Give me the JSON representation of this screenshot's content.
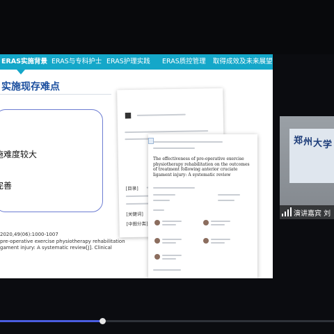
{
  "nav": {
    "items": [
      {
        "label": "ERAS实施背景",
        "active": true
      },
      {
        "label": "ERAS与专科护士",
        "active": false
      },
      {
        "label": "ERAS护理实践",
        "active": false
      },
      {
        "label": "ERAS质控管理",
        "active": false
      },
      {
        "label": "取得成效及未来展望",
        "active": false
      }
    ]
  },
  "slide": {
    "title": "实施现存难点",
    "points": [
      "施难度较大",
      "完善"
    ],
    "reference_lines": [
      "2020,49(06):1000-1007",
      "pre-operative exercise physiotherapy rehabilitation",
      "gament injury: A systematic review[J]. Clinical"
    ]
  },
  "papers": {
    "front_title": "The effectiveness of pre-operative exercise physiotherapy rehabilitation on the outcomes of treatment following anterior cruciate ligament injury: A systematic review",
    "back_chars": [
      "■",
      "[目录]",
      "[关键词]",
      "[中图分类]"
    ]
  },
  "webcam": {
    "name_label": "演讲嘉宾 刘",
    "board_chars": [
      "郑",
      "州",
      "大",
      "学"
    ]
  },
  "playback": {
    "progress": 0.307
  },
  "colors": {
    "nav": "#14a7c9",
    "title": "#1a4e9e",
    "box_border": "#6c7cd2",
    "progress": "#4a5de0"
  },
  "icons": [
    "signal-bars-icon"
  ]
}
